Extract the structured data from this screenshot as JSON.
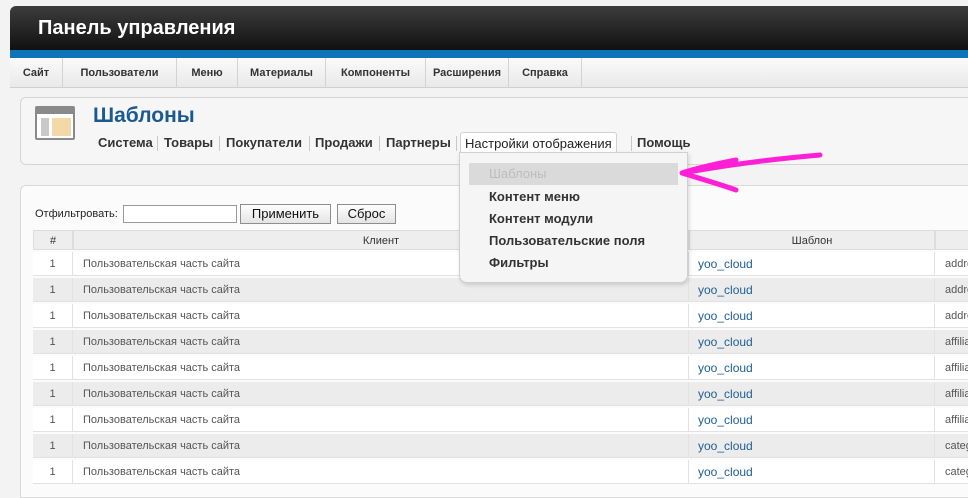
{
  "app": {
    "title": "Панель управления"
  },
  "menu": {
    "items": [
      "Сайт",
      "Пользователи",
      "Меню",
      "Материалы",
      "Компоненты",
      "Расширения",
      "Справка"
    ]
  },
  "page": {
    "title": "Шаблоны",
    "icon": "templates-icon"
  },
  "subnav": {
    "items": [
      "Система",
      "Товары",
      "Покупатели",
      "Продажи",
      "Партнеры",
      "Настройки отображения",
      "Помощь"
    ]
  },
  "dropdown": {
    "items": [
      "Шаблоны",
      "Контент меню",
      "Контент модули",
      "Пользовательские поля",
      "Фильтры"
    ]
  },
  "filter": {
    "label": "Отфильтровать:",
    "value": "",
    "apply_label": "Применить",
    "reset_label": "Сброс"
  },
  "table": {
    "headers": [
      "#",
      "Клиент",
      "Шаблон",
      ""
    ],
    "rows": [
      {
        "num": "1",
        "client": "Пользовательская часть сайта",
        "template": "yoo_cloud",
        "extra": "addre"
      },
      {
        "num": "1",
        "client": "Пользовательская часть сайта",
        "template": "yoo_cloud",
        "extra": "addre"
      },
      {
        "num": "1",
        "client": "Пользовательская часть сайта",
        "template": "yoo_cloud",
        "extra": "addre"
      },
      {
        "num": "1",
        "client": "Пользовательская часть сайта",
        "template": "yoo_cloud",
        "extra": "affilia"
      },
      {
        "num": "1",
        "client": "Пользовательская часть сайта",
        "template": "yoo_cloud",
        "extra": "affilia"
      },
      {
        "num": "1",
        "client": "Пользовательская часть сайта",
        "template": "yoo_cloud",
        "extra": "affilia"
      },
      {
        "num": "1",
        "client": "Пользовательская часть сайта",
        "template": "yoo_cloud",
        "extra": "affilia"
      },
      {
        "num": "1",
        "client": "Пользовательская часть сайта",
        "template": "yoo_cloud",
        "extra": "categ"
      },
      {
        "num": "1",
        "client": "Пользовательская часть сайта",
        "template": "yoo_cloud",
        "extra": "categ"
      }
    ]
  },
  "colors": {
    "brand_blue": "#0e74b8",
    "title_blue": "#1b5a91",
    "annotation_arrow": "#ff1fd6"
  }
}
